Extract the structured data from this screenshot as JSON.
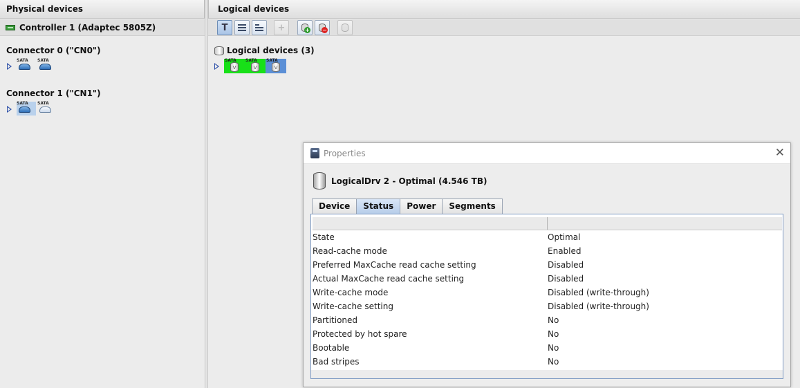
{
  "headers": {
    "physical": "Physical devices",
    "logical": "Logical devices"
  },
  "controller": {
    "label": "Controller 1 (Adaptec 5805Z)"
  },
  "toolbar": {
    "buttons": [
      {
        "name": "text-view",
        "label": "T",
        "selected": true
      },
      {
        "name": "list-view",
        "selected": false
      },
      {
        "name": "detail-view",
        "selected": false
      },
      {
        "name": "add",
        "label": "+",
        "disabled": true
      },
      {
        "name": "create-logical",
        "disabled": false
      },
      {
        "name": "delete-logical",
        "disabled": false
      },
      {
        "name": "disk-action",
        "disabled": true
      }
    ]
  },
  "physical": {
    "connectors": [
      {
        "title": "Connector 0 (\"CN0\")",
        "drives": [
          {
            "tag": "SATA"
          },
          {
            "tag": "SATA"
          }
        ]
      },
      {
        "title": "Connector 1 (\"CN1\")",
        "drives": [
          {
            "tag": "SATA",
            "selected": true
          },
          {
            "tag": "SATA"
          }
        ]
      }
    ]
  },
  "logical": {
    "title": "Logical devices (3)",
    "drives": [
      {
        "tag": "SATA",
        "mark": "V",
        "status": "green"
      },
      {
        "tag": "SATA",
        "mark": "V",
        "status": "green"
      },
      {
        "tag": "SATA",
        "mark": "V",
        "status": "selected"
      }
    ]
  },
  "dialog": {
    "title": "Properties",
    "heading": "LogicalDrv 2 - Optimal (4.546 TB)",
    "tabs": [
      "Device",
      "Status",
      "Power",
      "Segments"
    ],
    "active_tab": "Status",
    "rows": [
      {
        "key": "State",
        "value": "Optimal"
      },
      {
        "key": "Read-cache mode",
        "value": "Enabled"
      },
      {
        "key": "Preferred MaxCache read cache setting",
        "value": "Disabled"
      },
      {
        "key": "Actual MaxCache read cache setting",
        "value": "Disabled"
      },
      {
        "key": "Write-cache mode",
        "value": "Disabled (write-through)"
      },
      {
        "key": "Write-cache setting",
        "value": "Disabled (write-through)"
      },
      {
        "key": "Partitioned",
        "value": "No"
      },
      {
        "key": "Protected by hot spare",
        "value": "No"
      },
      {
        "key": "Bootable",
        "value": "No"
      },
      {
        "key": "Bad stripes",
        "value": "No"
      }
    ]
  },
  "colors": {
    "ok": "#18e018",
    "selected": "#5b8fd6"
  }
}
